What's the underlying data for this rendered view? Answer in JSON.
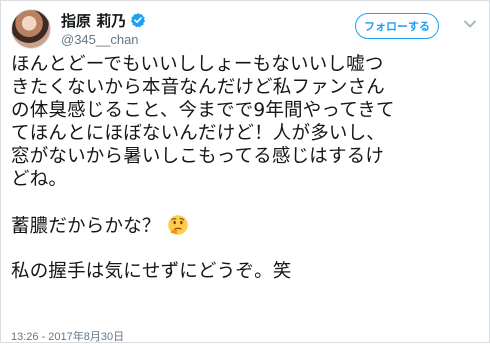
{
  "user": {
    "display_name": "指原 莉乃",
    "handle": "@345__chan",
    "verified": true
  },
  "follow_button": {
    "label": "フォローする"
  },
  "tweet": {
    "lines": [
      "ほんとどーでもいいししょーもないいし嘘つ",
      "きたくないから本音なんだけど私ファンさん",
      "の体臭感じること、今までで9年間やってきて",
      "てほんとにほぼないんだけど！人が多いし、",
      "窓がないから暑いしこもってる感じはするけ",
      "どね。",
      "",
      "蓄膿だからかな？",
      "",
      "私の握手は気にせずにどうぞ。笑"
    ],
    "emoji": "thinking-face-icon"
  },
  "timestamp": "13:26 - 2017年8月30日",
  "colors": {
    "accent": "#1da1f2",
    "text": "#14171a",
    "muted": "#657786"
  }
}
